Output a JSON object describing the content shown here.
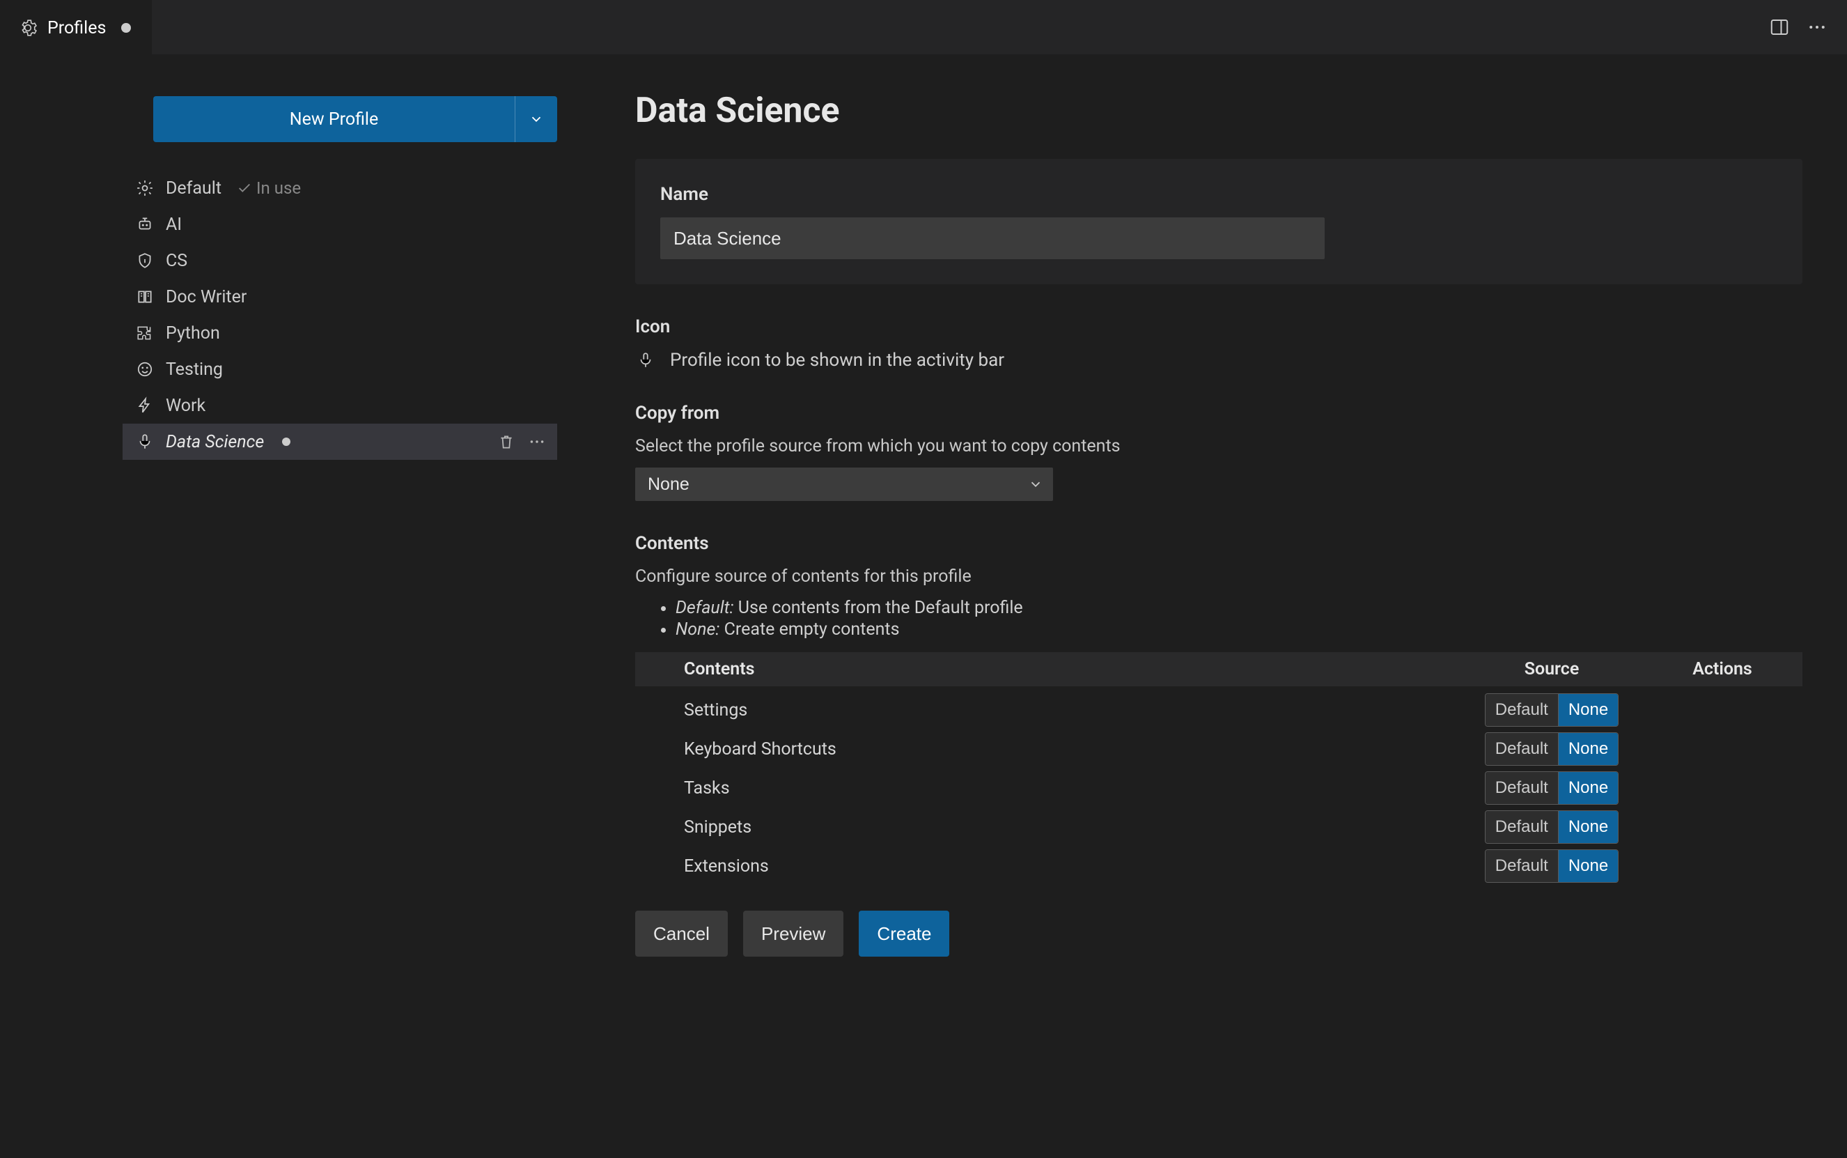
{
  "titlebar": {
    "tab_label": "Profiles",
    "dirty": true
  },
  "sidebar": {
    "new_profile_label": "New Profile",
    "profiles": [
      {
        "icon": "gear",
        "label": "Default",
        "in_use": true,
        "selected": false,
        "italic": false
      },
      {
        "icon": "robot",
        "label": "AI",
        "in_use": false,
        "selected": false,
        "italic": false
      },
      {
        "icon": "shield",
        "label": "CS",
        "in_use": false,
        "selected": false,
        "italic": false
      },
      {
        "icon": "book",
        "label": "Doc Writer",
        "in_use": false,
        "selected": false,
        "italic": false
      },
      {
        "icon": "puzzle",
        "label": "Python",
        "in_use": false,
        "selected": false,
        "italic": false
      },
      {
        "icon": "smiley",
        "label": "Testing",
        "in_use": false,
        "selected": false,
        "italic": false
      },
      {
        "icon": "bolt",
        "label": "Work",
        "in_use": false,
        "selected": false,
        "italic": false
      },
      {
        "icon": "mic",
        "label": "Data Science",
        "in_use": false,
        "selected": true,
        "italic": true
      }
    ],
    "in_use_label": "In use"
  },
  "main": {
    "title": "Data Science",
    "name_section": {
      "label": "Name",
      "value": "Data Science"
    },
    "icon_section": {
      "label": "Icon",
      "description": "Profile icon to be shown in the activity bar"
    },
    "copy_from_section": {
      "label": "Copy from",
      "description": "Select the profile source from which you want to copy contents",
      "selected": "None"
    },
    "contents_section": {
      "label": "Contents",
      "description": "Configure source of contents for this profile",
      "bullets": [
        {
          "term": "Default:",
          "text": " Use contents from the Default profile"
        },
        {
          "term": "None:",
          "text": " Create empty contents"
        }
      ],
      "columns": {
        "contents": "Contents",
        "source": "Source",
        "actions": "Actions"
      },
      "source_options": {
        "default": "Default",
        "none": "None"
      },
      "rows": [
        {
          "name": "Settings",
          "selected": "none"
        },
        {
          "name": "Keyboard Shortcuts",
          "selected": "none"
        },
        {
          "name": "Tasks",
          "selected": "none"
        },
        {
          "name": "Snippets",
          "selected": "none"
        },
        {
          "name": "Extensions",
          "selected": "none"
        }
      ]
    },
    "buttons": {
      "cancel": "Cancel",
      "preview": "Preview",
      "create": "Create"
    }
  }
}
